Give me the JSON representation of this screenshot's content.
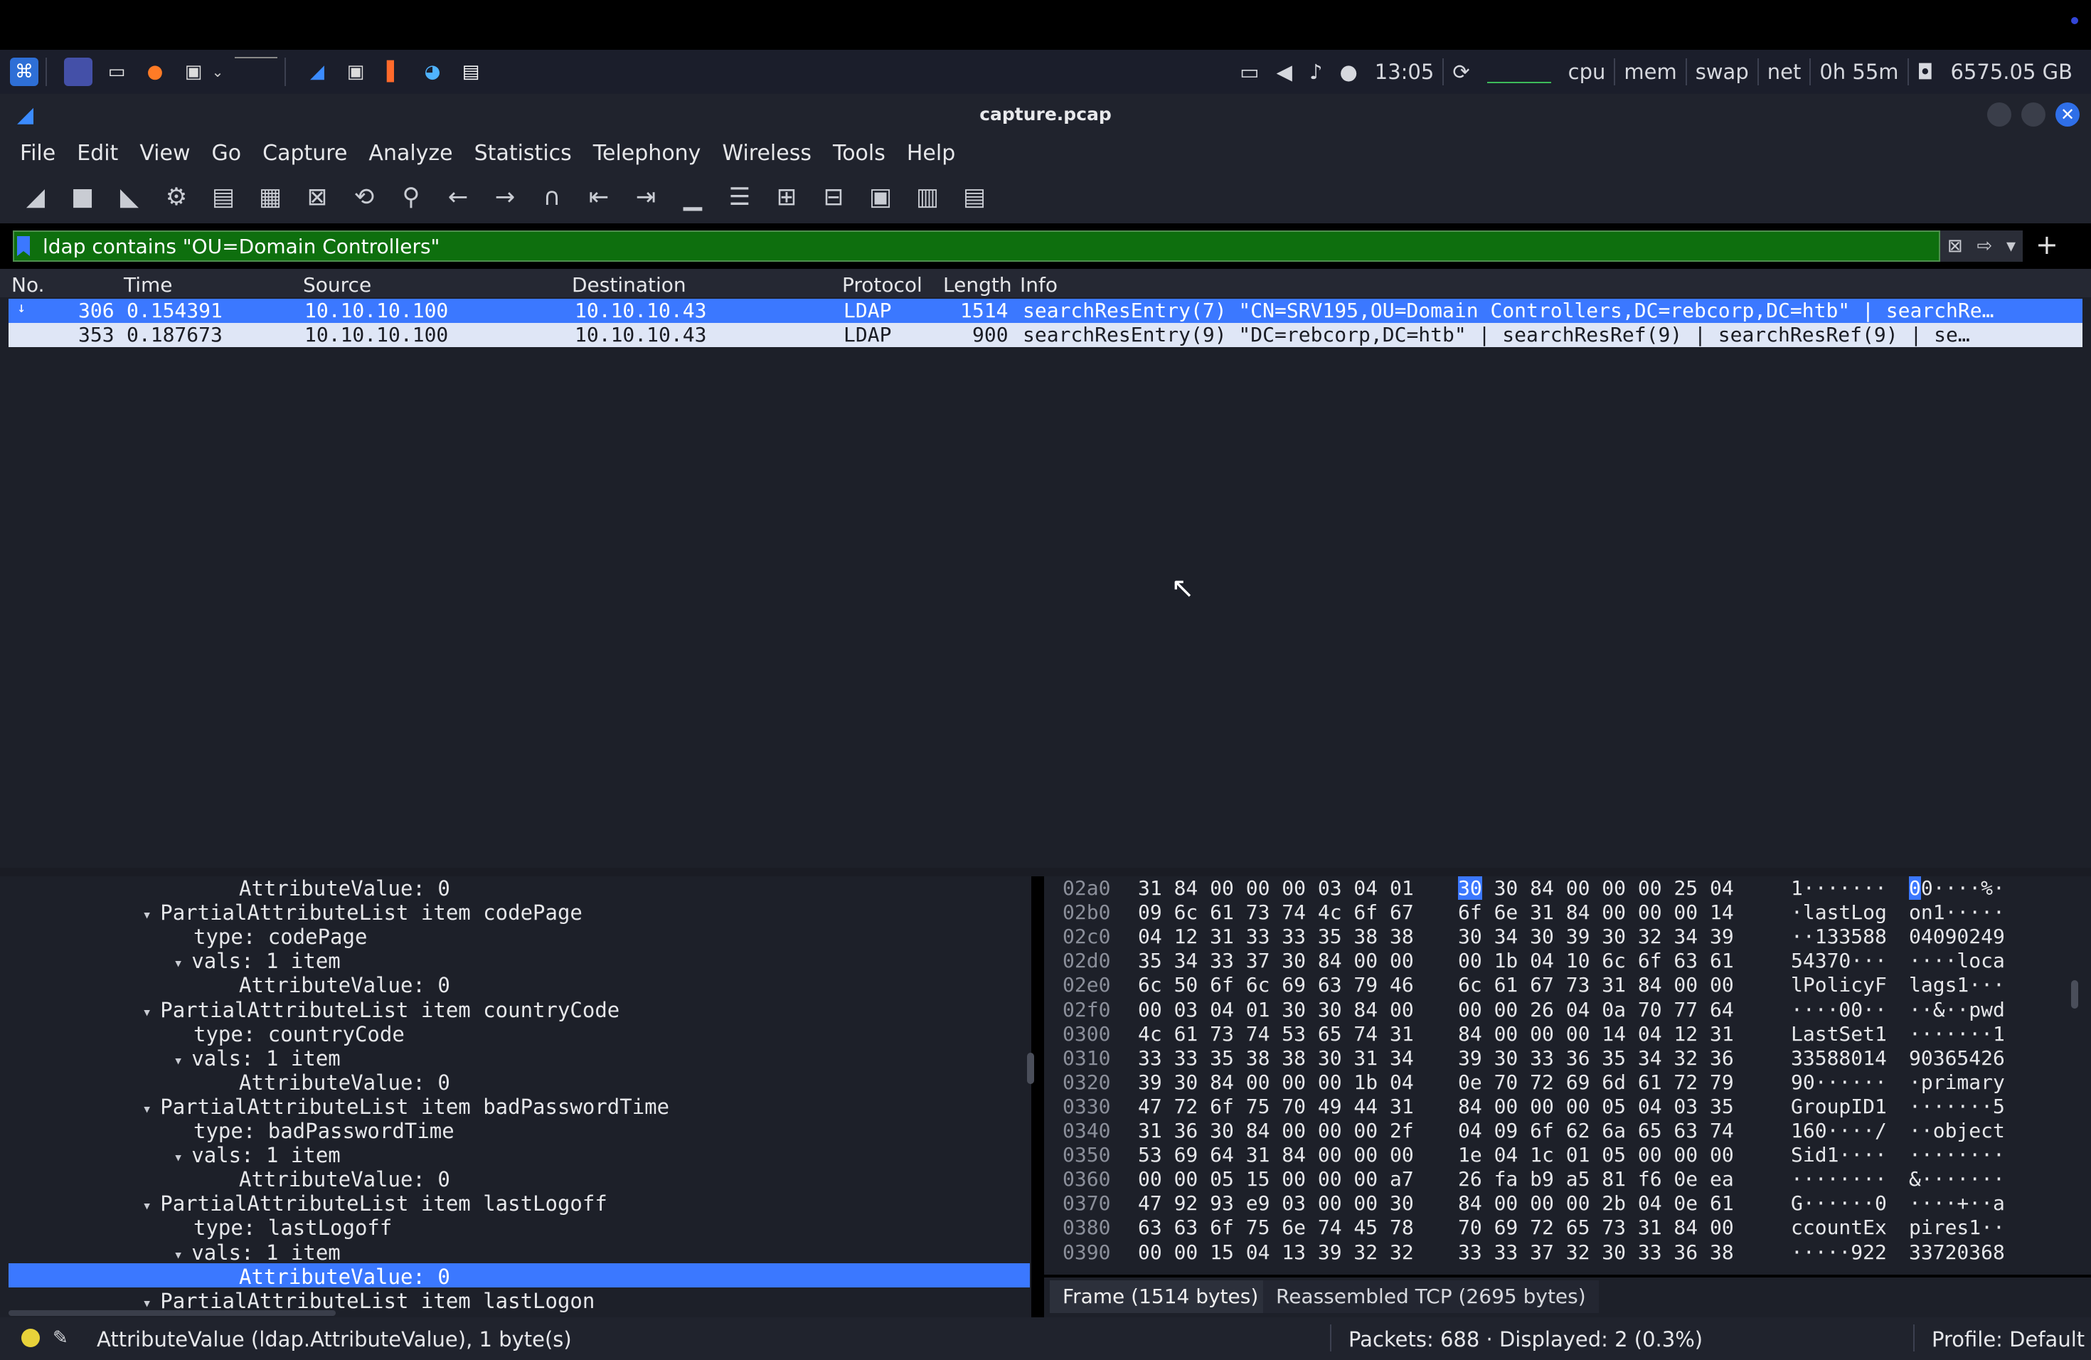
{
  "taskbar": {
    "time": "13:05",
    "monitors": [
      "cpu",
      "mem",
      "swap",
      "net"
    ],
    "uptime": "0h 55m",
    "disk": "6575.05 GB"
  },
  "window": {
    "title": "capture.pcap"
  },
  "menu": [
    "File",
    "Edit",
    "View",
    "Go",
    "Capture",
    "Analyze",
    "Statistics",
    "Telephony",
    "Wireless",
    "Tools",
    "Help"
  ],
  "filter": {
    "value": "ldap contains \"OU=Domain Controllers\""
  },
  "packet_list": {
    "headers": [
      "No.",
      "Time",
      "Source",
      "Destination",
      "Protocol",
      "Length",
      "Info"
    ],
    "rows": [
      {
        "no": "306",
        "time": "0.154391",
        "src": "10.10.10.100",
        "dst": "10.10.10.43",
        "proto": "LDAP",
        "len": "1514",
        "info": "searchResEntry(7) \"CN=SRV195,OU=Domain Controllers,DC=rebcorp,DC=htb\"  | searchRe…"
      },
      {
        "no": "353",
        "time": "0.187673",
        "src": "10.10.10.100",
        "dst": "10.10.10.43",
        "proto": "LDAP",
        "len": "900",
        "info": "searchResEntry(9) \"DC=rebcorp,DC=htb\"  | searchResRef(9)  | searchResRef(9)  | se…"
      }
    ]
  },
  "details": [
    {
      "text": "AttributeValue: 0",
      "indent": 3,
      "tri": ""
    },
    {
      "text": "PartialAttributeList item codePage",
      "indent": 1,
      "tri": "▾"
    },
    {
      "text": "type: codePage",
      "indent": 2,
      "tri": ""
    },
    {
      "text": "vals: 1 item",
      "indent": 2,
      "tri": "▾"
    },
    {
      "text": "AttributeValue: 0",
      "indent": 3,
      "tri": ""
    },
    {
      "text": "PartialAttributeList item countryCode",
      "indent": 1,
      "tri": "▾"
    },
    {
      "text": "type: countryCode",
      "indent": 2,
      "tri": ""
    },
    {
      "text": "vals: 1 item",
      "indent": 2,
      "tri": "▾"
    },
    {
      "text": "AttributeValue: 0",
      "indent": 3,
      "tri": ""
    },
    {
      "text": "PartialAttributeList item badPasswordTime",
      "indent": 1,
      "tri": "▾"
    },
    {
      "text": "type: badPasswordTime",
      "indent": 2,
      "tri": ""
    },
    {
      "text": "vals: 1 item",
      "indent": 2,
      "tri": "▾"
    },
    {
      "text": "AttributeValue: 0",
      "indent": 3,
      "tri": ""
    },
    {
      "text": "PartialAttributeList item lastLogoff",
      "indent": 1,
      "tri": "▾"
    },
    {
      "text": "type: lastLogoff",
      "indent": 2,
      "tri": ""
    },
    {
      "text": "vals: 1 item",
      "indent": 2,
      "tri": "▾"
    },
    {
      "text": "AttributeValue: 0",
      "indent": 3,
      "tri": "",
      "selected": true
    },
    {
      "text": "PartialAttributeList item lastLogon",
      "indent": 1,
      "tri": "▾"
    }
  ],
  "bytes": [
    {
      "off": "02a0",
      "hex1": "31 84 00 00 00 03 04 01",
      "hex2": "30 30 84 00 00 00 25 04",
      "asc1": "1·······",
      "asc2": "00····%·"
    },
    {
      "off": "02b0",
      "hex1": "09 6c 61 73 74 4c 6f 67",
      "hex2": "6f 6e 31 84 00 00 00 14",
      "asc1": "·lastLog",
      "asc2": "on1·····"
    },
    {
      "off": "02c0",
      "hex1": "04 12 31 33 33 35 38 38",
      "hex2": "30 34 30 39 30 32 34 39",
      "asc1": "··133588",
      "asc2": "04090249"
    },
    {
      "off": "02d0",
      "hex1": "35 34 33 37 30 84 00 00",
      "hex2": "00 1b 04 10 6c 6f 63 61",
      "asc1": "54370···",
      "asc2": "····loca"
    },
    {
      "off": "02e0",
      "hex1": "6c 50 6f 6c 69 63 79 46",
      "hex2": "6c 61 67 73 31 84 00 00",
      "asc1": "lPolicyF",
      "asc2": "lags1···"
    },
    {
      "off": "02f0",
      "hex1": "00 03 04 01 30 30 84 00",
      "hex2": "00 00 26 04 0a 70 77 64",
      "asc1": "····00··",
      "asc2": "··&··pwd"
    },
    {
      "off": "0300",
      "hex1": "4c 61 73 74 53 65 74 31",
      "hex2": "84 00 00 00 14 04 12 31",
      "asc1": "LastSet1",
      "asc2": "·······1"
    },
    {
      "off": "0310",
      "hex1": "33 33 35 38 38 30 31 34",
      "hex2": "39 30 33 36 35 34 32 36",
      "asc1": "33588014",
      "asc2": "90365426"
    },
    {
      "off": "0320",
      "hex1": "39 30 84 00 00 00 1b 04",
      "hex2": "0e 70 72 69 6d 61 72 79",
      "asc1": "90······",
      "asc2": "·primary"
    },
    {
      "off": "0330",
      "hex1": "47 72 6f 75 70 49 44 31",
      "hex2": "84 00 00 00 05 04 03 35",
      "asc1": "GroupID1",
      "asc2": "·······5"
    },
    {
      "off": "0340",
      "hex1": "31 36 30 84 00 00 00 2f",
      "hex2": "04 09 6f 62 6a 65 63 74",
      "asc1": "160····/",
      "asc2": "··object"
    },
    {
      "off": "0350",
      "hex1": "53 69 64 31 84 00 00 00",
      "hex2": "1e 04 1c 01 05 00 00 00",
      "asc1": "Sid1····",
      "asc2": "········"
    },
    {
      "off": "0360",
      "hex1": "00 00 05 15 00 00 00 a7",
      "hex2": "26 fa b9 a5 81 f6 0e ea",
      "asc1": "········",
      "asc2": "&·······"
    },
    {
      "off": "0370",
      "hex1": "47 92 93 e9 03 00 00 30",
      "hex2": "84 00 00 00 2b 04 0e 61",
      "asc1": "G······0",
      "asc2": "····+··a"
    },
    {
      "off": "0380",
      "hex1": "63 63 6f 75 6e 74 45 78",
      "hex2": "70 69 72 65 73 31 84 00",
      "asc1": "ccountEx",
      "asc2": "pires1··"
    },
    {
      "off": "0390",
      "hex1": "00 00 15 04 13 39 32 32",
      "hex2": "33 33 37 32 30 33 36 38",
      "asc1": "·····922",
      "asc2": "33720368"
    }
  ],
  "byte_tabs": [
    "Frame (1514 bytes)",
    "Reassembled TCP (2695 bytes)"
  ],
  "status": {
    "field": "AttributeValue (ldap.AttributeValue), 1 byte(s)",
    "packets": "Packets: 688 · Displayed: 2 (0.3%)",
    "profile": "Profile: Default"
  },
  "colors": {
    "accent": "#3b78ff",
    "filter_ok": "#0e6f0e",
    "bg": "#1d2029"
  }
}
